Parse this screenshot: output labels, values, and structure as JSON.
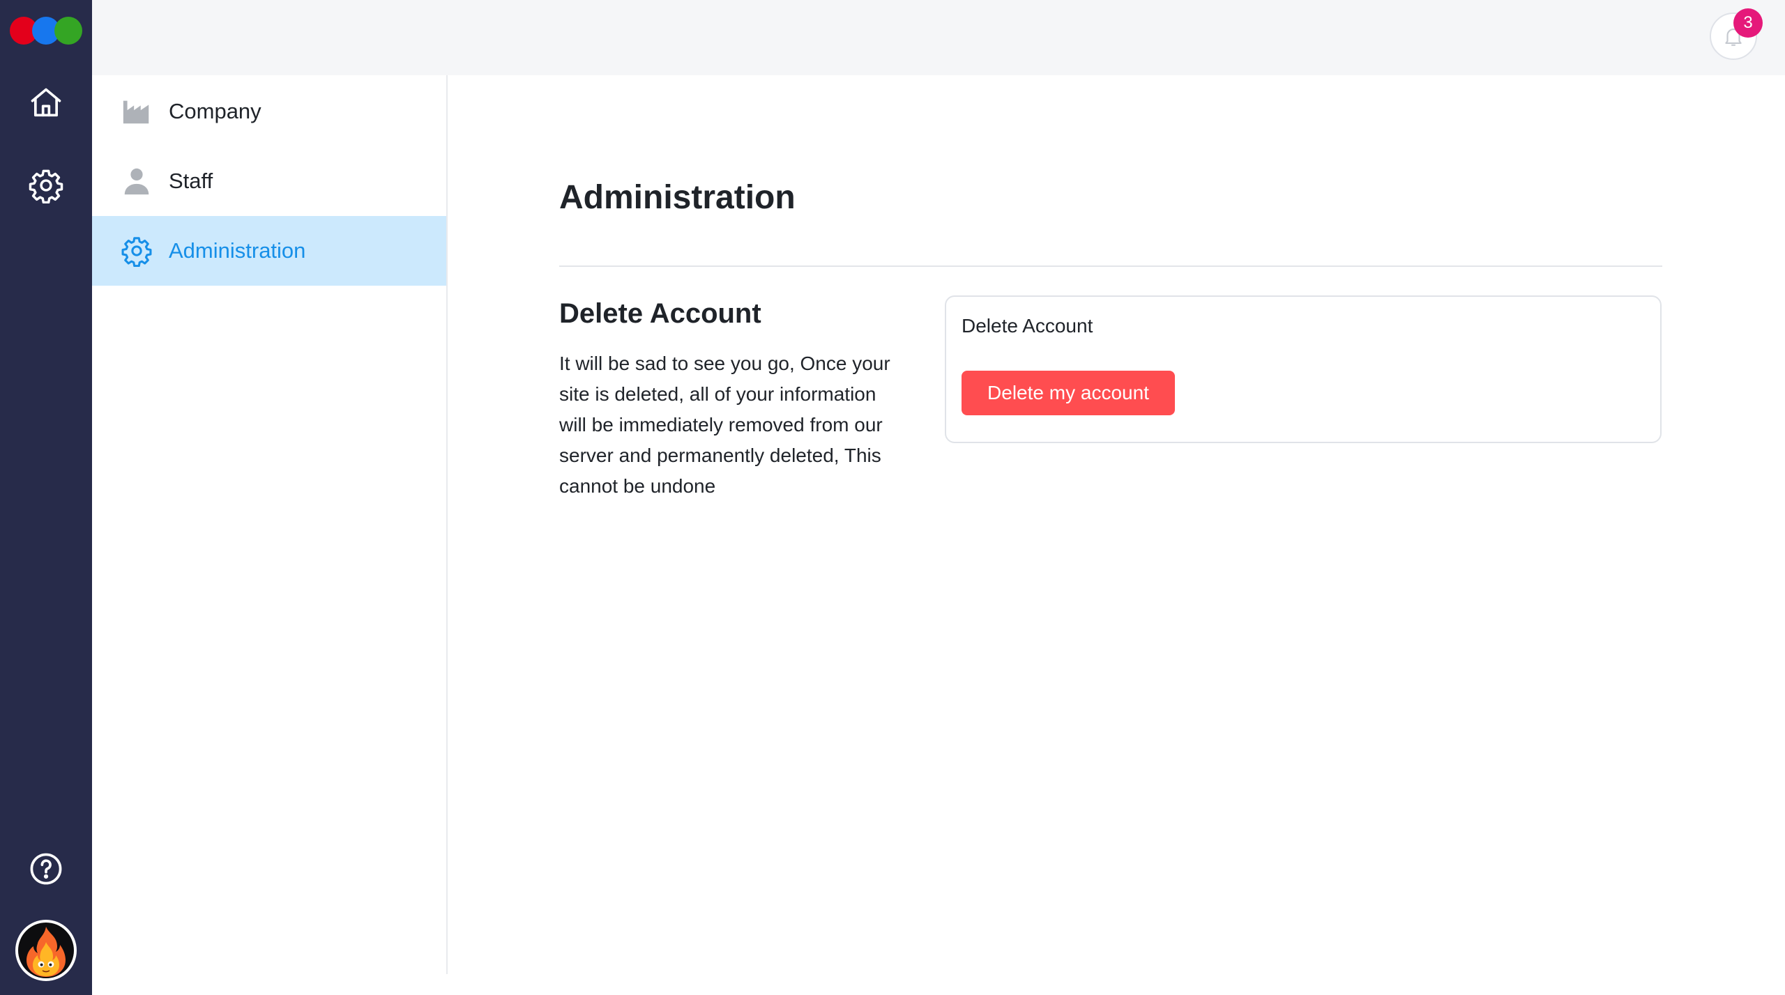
{
  "app": {
    "logo_colors": [
      "#e3001b",
      "#1777ee",
      "#34a524"
    ],
    "rail": {
      "items": [
        {
          "name": "home",
          "icon": "home-icon"
        },
        {
          "name": "settings",
          "icon": "gear-icon"
        }
      ],
      "bottom": [
        {
          "name": "help",
          "icon": "question-circle-icon"
        },
        {
          "name": "avatar",
          "icon": "fire-avatar-icon"
        }
      ]
    }
  },
  "header": {
    "notifications": {
      "icon": "bell-icon",
      "count": "3"
    }
  },
  "subnav": {
    "items": [
      {
        "label": "Company",
        "icon": "factory-icon",
        "active": false
      },
      {
        "label": "Staff",
        "icon": "person-icon",
        "active": false
      },
      {
        "label": "Administration",
        "icon": "gear-icon",
        "active": true
      }
    ]
  },
  "main": {
    "title": "Administration",
    "section": {
      "title": "Delete Account",
      "description": "It will be sad to see you go, Once your site is deleted, all of your information will be immediately removed from our server and permanently deleted, This cannot be undone",
      "card": {
        "label": "Delete Account",
        "button_label": "Delete my account"
      }
    }
  },
  "colors": {
    "rail_bg": "#272b4a",
    "accent": "#168fe8",
    "active_bg": "#cce9fd",
    "danger": "#ff4d50",
    "badge": "#e5197a"
  }
}
